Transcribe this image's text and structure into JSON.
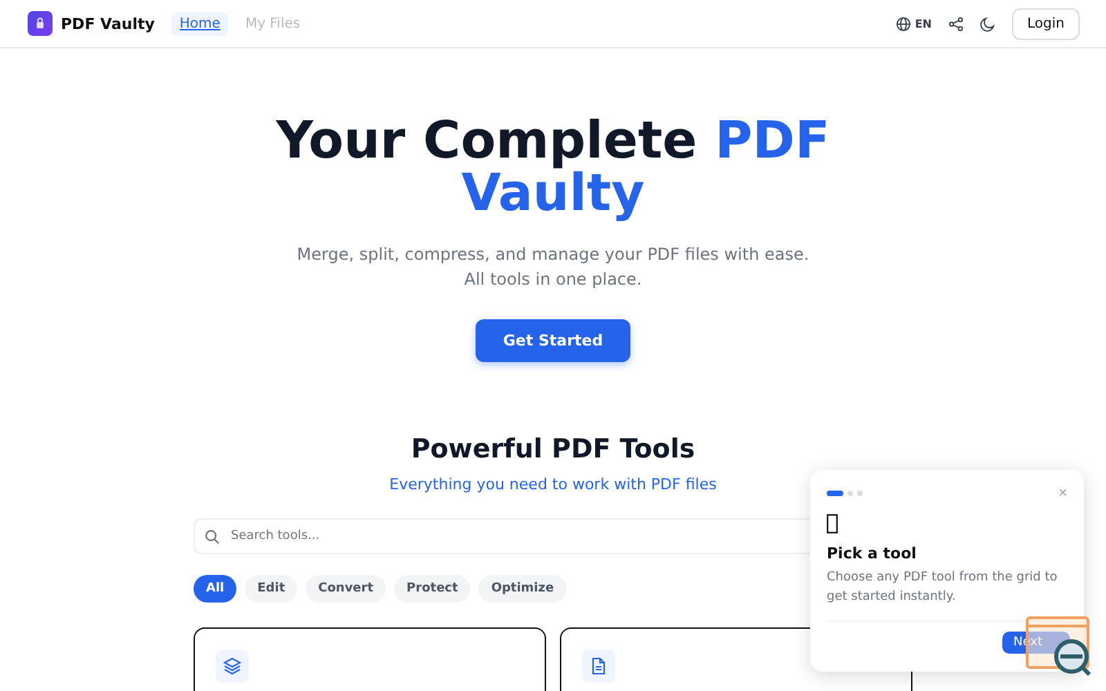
{
  "header": {
    "brand": "PDF Vaulty",
    "nav": [
      {
        "label": "Home",
        "selected": true
      },
      {
        "label": "My Files",
        "selected": false
      }
    ],
    "language": "EN",
    "login": "Login"
  },
  "hero": {
    "title": "Your Complete ",
    "title_accent": "PDF Vaulty",
    "subtitle": "Merge, split, compress, and manage your PDF files with ease.",
    "subtitle_2": "All tools in one place.",
    "cta": "Get Started"
  },
  "tools": {
    "title": "Powerful PDF Tools",
    "subtitle": "Everything you need to work with PDF files",
    "search": {
      "placeholder": "Search tools..."
    },
    "filters": [
      {
        "label": "All",
        "selected": true
      },
      {
        "label": "Edit",
        "selected": false
      },
      {
        "label": "Convert",
        "selected": false
      },
      {
        "label": "Protect",
        "selected": false
      },
      {
        "label": "Optimize",
        "selected": false
      }
    ],
    "cards": [
      {
        "kind": "layers"
      },
      {
        "kind": "document"
      }
    ]
  },
  "tour": {
    "steps": [
      {
        "selected": true
      },
      {
        "selected": false
      },
      {
        "selected": false
      }
    ],
    "close": "×",
    "title": "Pick a tool",
    "text": "Choose any PDF tool from the grid to get started instantly.",
    "next": "Next"
  }
}
